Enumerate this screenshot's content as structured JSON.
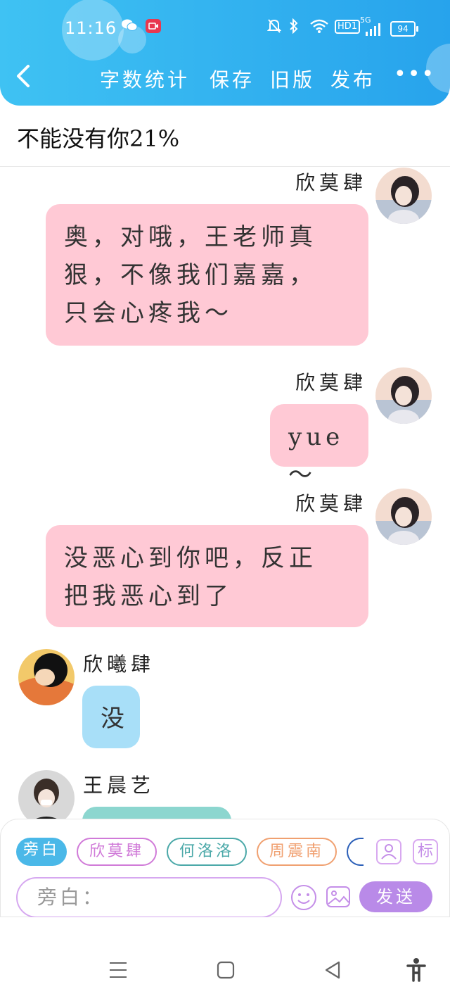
{
  "status_bar": {
    "time": "11:16",
    "network": "5G",
    "hd": "HD1",
    "battery": "94"
  },
  "header": {
    "word_count_label": "字数统计",
    "save_label": "保存",
    "old_version_label": "旧版",
    "publish_label": "发布",
    "more_label": "•••"
  },
  "title": "不能没有你21%",
  "messages": [
    {
      "sender": "欣莫肆",
      "side": "right",
      "text_lines": [
        "奥，对哦，王老师真",
        "狠，不像我们嘉嘉，",
        "只会心疼我～"
      ],
      "color": "#ffc9d5"
    },
    {
      "sender": "欣莫肆",
      "side": "right",
      "text_lines": [
        "yue～"
      ],
      "color": "#ffc9d5"
    },
    {
      "sender": "欣莫肆",
      "side": "right",
      "text_lines": [
        "没恶心到你吧，反正",
        "把我恶心到了"
      ],
      "color": "#ffc9d5"
    },
    {
      "sender": "欣曦肆",
      "side": "left",
      "text_lines": [
        "没"
      ],
      "color": "#a8dff8"
    },
    {
      "sender": "王晨艺",
      "side": "left",
      "text_lines": [
        ""
      ],
      "color": "#8cd6cf"
    }
  ],
  "composer": {
    "chips": [
      {
        "label": "旁白",
        "color": "#4ab8e8"
      },
      {
        "label": "欣莫肆",
        "color": "#d07ad8"
      },
      {
        "label": "何洛洛",
        "color": "#4aa8a8"
      },
      {
        "label": "周震南",
        "color": "#f0a070"
      }
    ],
    "tag_label": "标",
    "input_placeholder": "旁白：",
    "send_label": "发送"
  },
  "icons": {
    "back": "back-arrow-icon",
    "wechat": "wechat-icon",
    "record": "screen-record-icon",
    "mute": "mute-bell-icon",
    "bluetooth": "bluetooth-icon",
    "wifi": "wifi-icon",
    "signal": "signal-icon",
    "person": "person-icon",
    "emoji": "emoji-icon",
    "image": "image-icon"
  }
}
